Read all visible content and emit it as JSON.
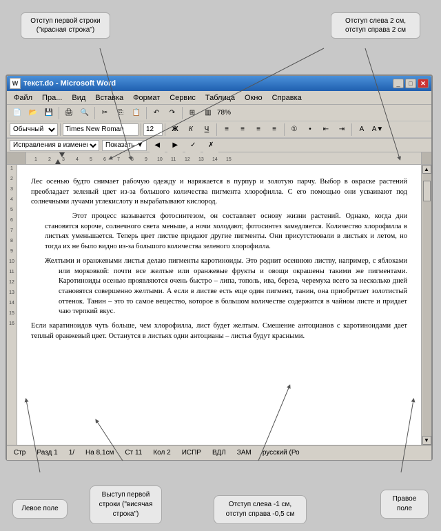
{
  "annotations": {
    "top_left_label": "Отступ первой строки\n(\"красная строка\")",
    "top_right_label": "Отступ слева 2 см,\nотступ справа 2 см",
    "bottom_left_field": "Левое\nполе",
    "bottom_second": "Выступ первой\nстроки (\"висячая\nстрока\")",
    "bottom_third": "Отступ слева -1 см,\nотступ справа -0,5 см",
    "bottom_right_field": "Правое\nполе"
  },
  "window": {
    "title": "текст.do - Microsoft Word",
    "icon_label": "W"
  },
  "menu": {
    "items": [
      "Файл",
      "Пра...",
      "Вид",
      "Вставка",
      "Формат",
      "Сервис",
      "Таблица",
      "Окно",
      "Справка"
    ]
  },
  "toolbar": {
    "style_label": "Обычный",
    "font_name": "Times New Roman",
    "font_size": "12",
    "bold": "Ж",
    "italic": "К",
    "underline": "Ч"
  },
  "review_bar": {
    "label": "Исправления в измененном документе",
    "show_button": "Показать ▼"
  },
  "status_bar": {
    "str": "Стр",
    "razdel": "Разд 1",
    "page": "1/",
    "na": "На 8,1см",
    "st": "Ст 11",
    "kol": "Кол 2",
    "ispr": "ИСПР",
    "vdl": "ВДЛ",
    "zam": "ЗАМ",
    "lang": "русский (Ро"
  },
  "document": {
    "para1": "Лес осенью будто снимает рабочую одежду и наряжается в пурпур и золотую парчу. Выбор в окраске растений преобладает зеленый цвет из-за большого количества пигмента хлорофилла. С его помощью они усваивают под солнечными лучами углекислоту и вырабатывают кислород.",
    "para2": "Этот процесс называется фотосинтезом, он составляет основу жизни растений. Однако, когда дни становятся короче, солнечного света меньше, а ночи холодают, фотосинтез замедляется. Количество хлорофилла в листьях уменьшается. Теперь цвет листве придают другие пигменты. Они присутствовали в листьях и летом, но тогда их не было видно из-за большого количества зеленого хлорофилла.",
    "para3": "Желтыми и оранжевыми листья делаю пигменты каротиноиды. Это роднит осеннюю листву, например, с яблоками или морковкой: почти все желтые или оранжевые фрукты и овощи окрашены такими же пигментами. Каротиноиды осенью проявляются очень быстро – липа, тополь, ива, береза, черемуха всего за несколько дней становятся совершенно желтыми. А если в листве есть еще один пигмент, танин, она приобретает золотистый оттенок. Танин – это то самое вещество, которое в большом количестве содержится в чайном листе и придает чаю терпкий вкус.",
    "para4": "Если каратиноидов чуть больше, чем хлорофилла, лист будет желтым. Смешение антоцианов с каротиноидами дает теплый оранжевый цвет. Останутся в листьях одни антоцианы – листья будут красными."
  }
}
